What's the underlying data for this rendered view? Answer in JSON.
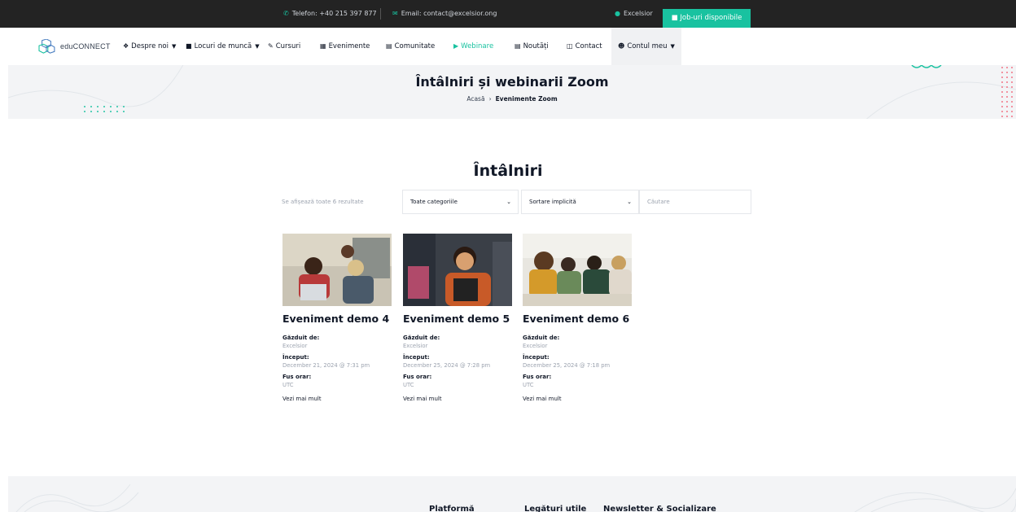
{
  "topbar": {
    "phone": "Telefon: +40 215 397 877",
    "email": "Email: contact@excelsior.ong",
    "user": "Excelsior",
    "jobs": "Job-uri disponibile"
  },
  "brand": {
    "name": "eduCONNECT"
  },
  "nav": {
    "about": "Despre noi",
    "jobs": "Locuri de muncă",
    "courses": "Cursuri",
    "events": "Evenimente",
    "community": "Comunitate",
    "webinars": "Webinare",
    "news": "Noutăți",
    "contact": "Contact",
    "account": "Contul meu"
  },
  "hero": {
    "title": "Întâlniri și webinarii Zoom",
    "breadcrumb_home": "Acasă",
    "breadcrumb_sep": "›",
    "breadcrumb_current": "Evenimente Zoom"
  },
  "section": {
    "title": "Întâlniri",
    "results": "Se afișează toate 6 rezultate",
    "category_select": "Toate categoriile",
    "sort_select": "Sortare implicită",
    "search_placeholder": "Căutare"
  },
  "labels": {
    "host": "Găzduit de:",
    "start": "Început:",
    "timezone": "Fus orar:",
    "more": "Vezi mai mult"
  },
  "cards": [
    {
      "title": "Eveniment demo 4",
      "host": "Excelsior",
      "start": "December 21, 2024 @ 7:31 pm",
      "timezone": "UTC"
    },
    {
      "title": "Eveniment demo 5",
      "host": "Excelsior",
      "start": "December 25, 2024 @ 7:28 pm",
      "timezone": "UTC"
    },
    {
      "title": "Eveniment demo 6",
      "host": "Excelsior",
      "start": "December 25, 2024 @ 7:18 pm",
      "timezone": "UTC"
    }
  ],
  "footer": {
    "platform": "Platformă",
    "links": "Legături utile",
    "newsletter": "Newsletter & Socializare"
  },
  "colors": {
    "accent": "#19c2a0",
    "topbar": "#232323"
  }
}
